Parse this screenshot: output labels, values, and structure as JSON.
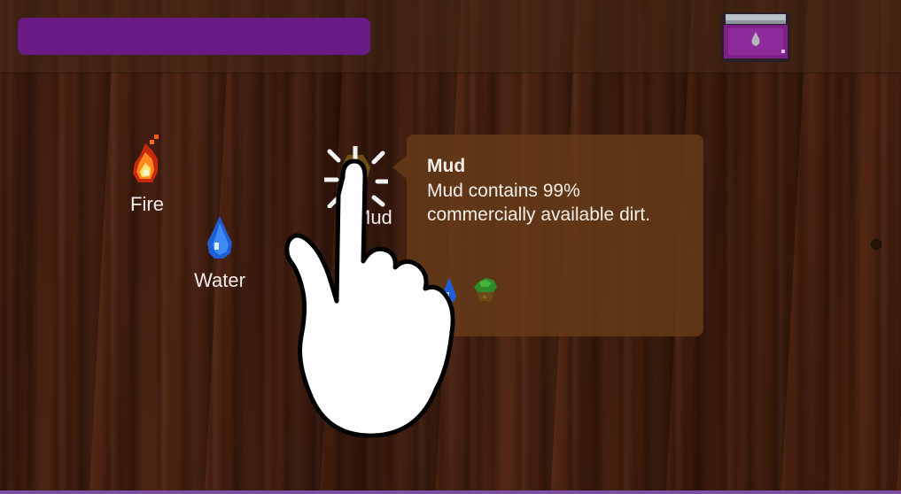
{
  "topbar": {
    "progress_color": "#6a1a84",
    "potion_icon": "potion-jar-icon"
  },
  "elements": [
    {
      "label": "Fire",
      "icon": "fire-icon"
    },
    {
      "label": "Water",
      "icon": "water-drop-icon"
    },
    {
      "label": "Mud",
      "icon": "mud-icon"
    }
  ],
  "tooltip": {
    "title": "Mud",
    "description": "Mud contains 99% commercially available dirt.",
    "ingredients": [
      "water-drop-icon",
      "earth-icon"
    ]
  },
  "tutorial": {
    "pointer": "tap-hand-icon"
  }
}
